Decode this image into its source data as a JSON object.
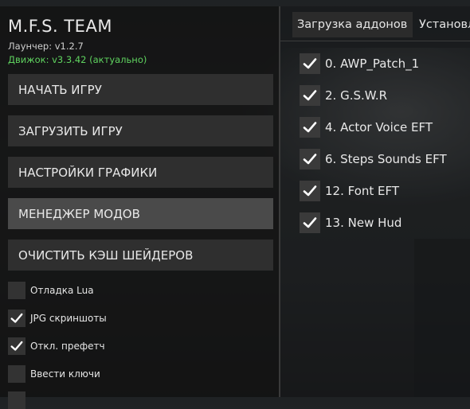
{
  "app": {
    "title": "M.F.S. TEAM",
    "launcher_version": "Лаунчер: v1.2.7",
    "engine_version": "Движок: v3.3.42 (актуально)",
    "engine_status_color": "#5fd35f"
  },
  "menu": {
    "buttons": [
      {
        "label": "НАЧАТЬ ИГРУ",
        "active": false
      },
      {
        "label": "ЗАГРУЗИТЬ ИГРУ",
        "active": false
      },
      {
        "label": "НАСТРОЙКИ ГРАФИКИ",
        "active": false
      },
      {
        "label": "МЕНЕДЖЕР МОДОВ",
        "active": true
      },
      {
        "label": "ОЧИСТИТЬ КЭШ ШЕЙДЕРОВ",
        "active": false
      }
    ]
  },
  "options": [
    {
      "label": "Отладка Lua",
      "checked": false
    },
    {
      "label": "JPG скриншоты",
      "checked": true
    },
    {
      "label": "Откл. префетч",
      "checked": true
    },
    {
      "label": "Ввести ключи",
      "checked": false
    }
  ],
  "tabs": [
    {
      "label": "Загрузка аддонов",
      "active": true
    },
    {
      "label": "Установл",
      "active": false
    }
  ],
  "addons": [
    {
      "label": "0. AWP_Patch_1",
      "checked": true
    },
    {
      "label": "2. G.S.W.R",
      "checked": true
    },
    {
      "label": "4. Actor Voice EFT",
      "checked": true
    },
    {
      "label": "6. Steps Sounds EFT",
      "checked": true
    },
    {
      "label": "12. Font EFT",
      "checked": true
    },
    {
      "label": "13. New Hud",
      "checked": true
    }
  ],
  "icons": {
    "checkbox_checked": "checkmark-icon"
  }
}
